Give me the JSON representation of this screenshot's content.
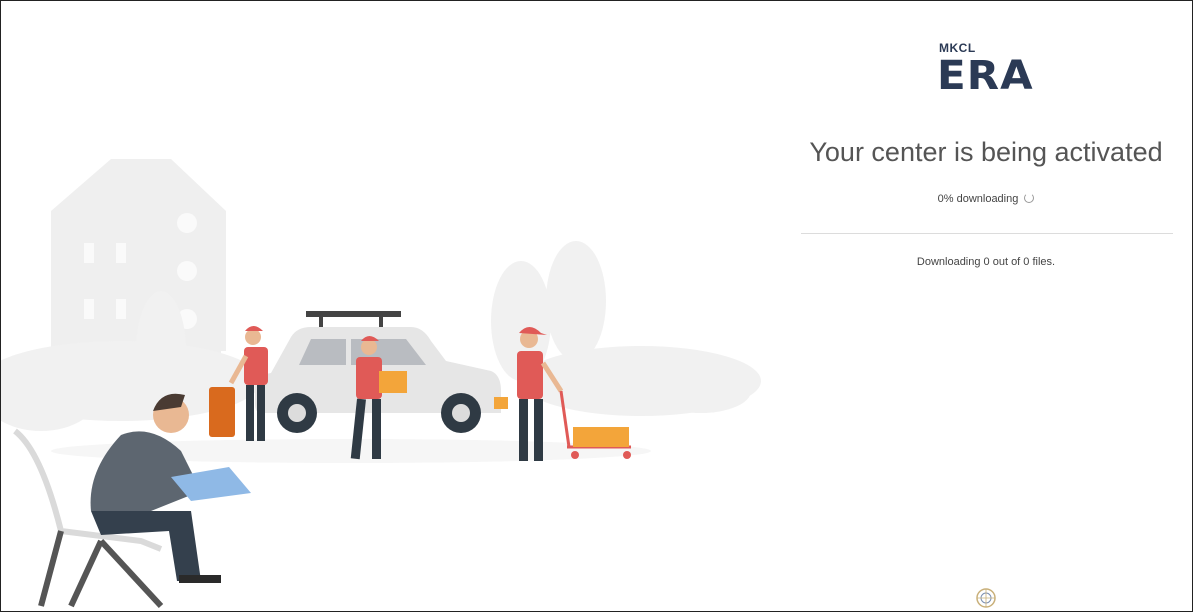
{
  "logo": {
    "small_text": "MKCL",
    "big_text": "ERA"
  },
  "status": {
    "headline": "Your center is being activated",
    "progress_text": "0% downloading",
    "files_text": "Downloading 0 out of 0 files."
  },
  "progress": {
    "percent": 0,
    "files_done": 0,
    "files_total": 0
  },
  "icons": {
    "spinner": "loading-spinner-icon",
    "footer": "emblem-icon"
  },
  "colors": {
    "brand": "#2b3a55",
    "accent_orange": "#e8862e",
    "accent_red": "#e05a57"
  }
}
